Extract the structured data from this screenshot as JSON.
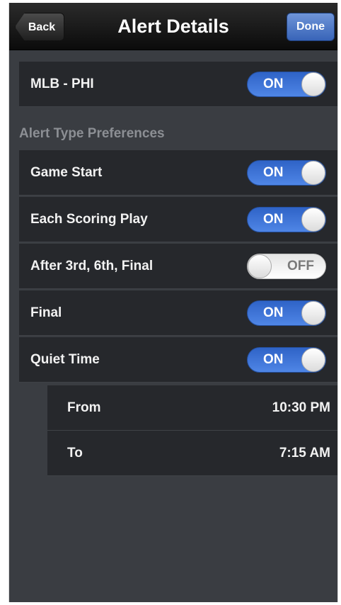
{
  "navbar": {
    "title": "Alert Details",
    "back_label": "Back",
    "done_label": "Done"
  },
  "team_row": {
    "label": "MLB - PHI",
    "state": "ON"
  },
  "section_header": "Alert Type Preferences",
  "preferences": [
    {
      "label": "Game Start",
      "state": "ON"
    },
    {
      "label": "Each Scoring Play",
      "state": "ON"
    },
    {
      "label": "After 3rd, 6th, Final",
      "state": "OFF"
    },
    {
      "label": "Final",
      "state": "ON"
    },
    {
      "label": "Quiet Time",
      "state": "ON"
    }
  ],
  "quiet_time": {
    "from_label": "From",
    "from_value": "10:30 PM",
    "to_label": "To",
    "to_value": "7:15 AM"
  },
  "colors": {
    "toggle_on": "#3b6fd2",
    "done_button": "#4a77c9",
    "background": "#3a3d42",
    "row_background": "#26282c"
  }
}
